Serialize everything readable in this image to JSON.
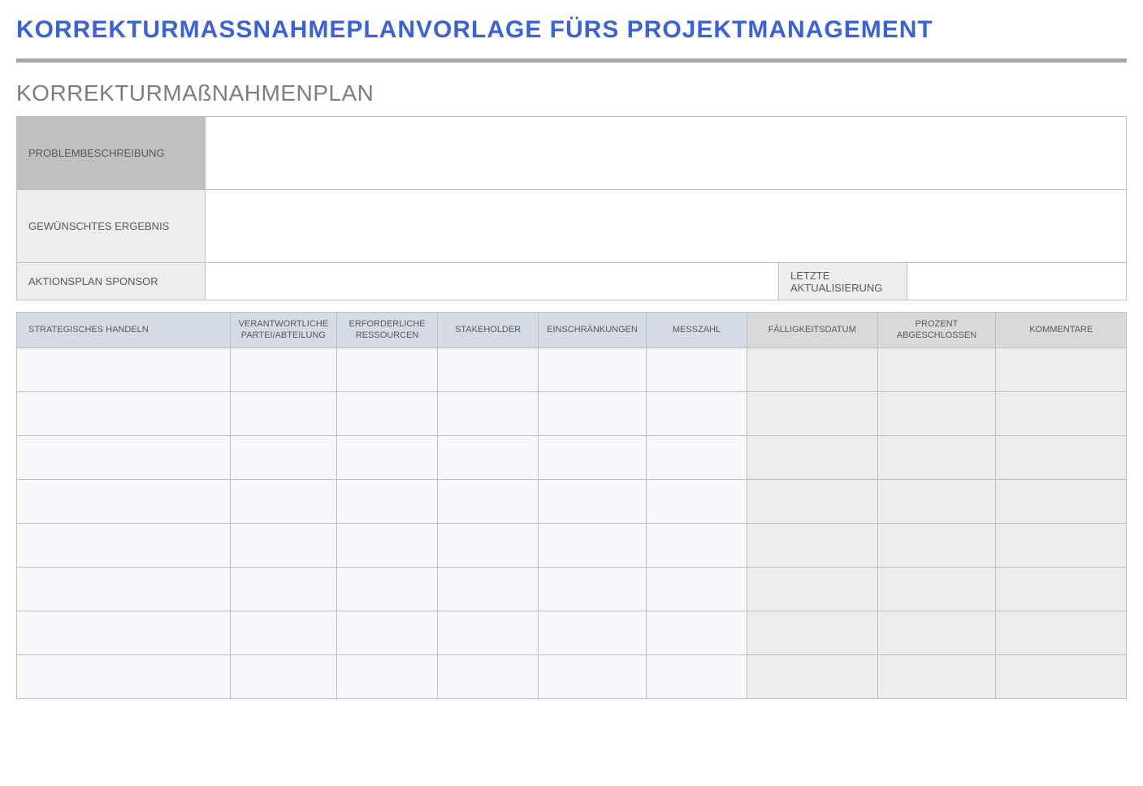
{
  "header": {
    "title": "KORREKTURMASSNAHMEPLANVORLAGE FÜRS PROJEKTMANAGEMENT",
    "section_title": "KORREKTURMAßNAHMENPLAN"
  },
  "info": {
    "problem_label": "PROBLEMBESCHREIBUNG",
    "problem_value": "",
    "desired_label": "GEWÜNSCHTES ERGEBNIS",
    "desired_value": "",
    "sponsor_label": "AKTIONSPLAN SPONSOR",
    "sponsor_value": "",
    "last_update_label": "LETZTE AKTUALISIERUNG",
    "last_update_value": ""
  },
  "action_table": {
    "headers": [
      "STRATEGISCHES HANDELN",
      "VERANTWORTLICHE PARTEI/ABTEILUNG",
      "ERFORDERLICHE RESSOURCEN",
      "STAKEHOLDER",
      "EINSCHRÄNKUNGEN",
      "MESSZAHL",
      "FÄLLIGKEITSDATUM",
      "PROZENT ABGESCHLOSSEN",
      "KOMMENTARE"
    ],
    "rows": [
      [
        "",
        "",
        "",
        "",
        "",
        "",
        "",
        "",
        ""
      ],
      [
        "",
        "",
        "",
        "",
        "",
        "",
        "",
        "",
        ""
      ],
      [
        "",
        "",
        "",
        "",
        "",
        "",
        "",
        "",
        ""
      ],
      [
        "",
        "",
        "",
        "",
        "",
        "",
        "",
        "",
        ""
      ],
      [
        "",
        "",
        "",
        "",
        "",
        "",
        "",
        "",
        ""
      ],
      [
        "",
        "",
        "",
        "",
        "",
        "",
        "",
        "",
        ""
      ],
      [
        "",
        "",
        "",
        "",
        "",
        "",
        "",
        "",
        ""
      ],
      [
        "",
        "",
        "",
        "",
        "",
        "",
        "",
        "",
        ""
      ]
    ]
  }
}
